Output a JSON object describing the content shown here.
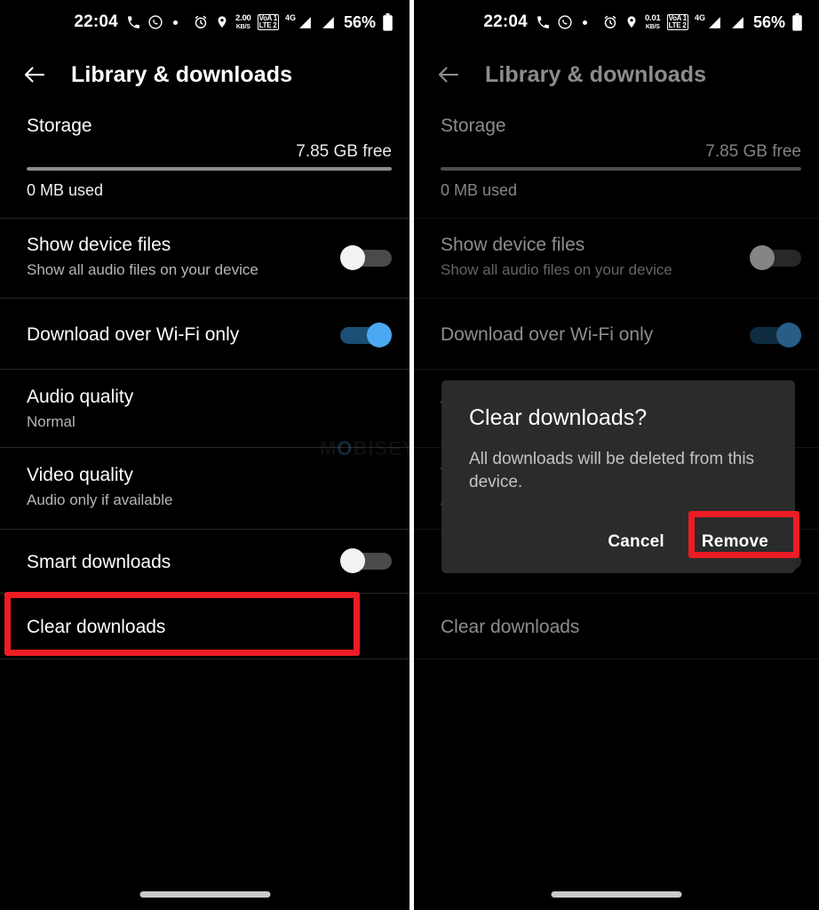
{
  "status_bar": {
    "time": "22:04",
    "icons": [
      "phone-icon",
      "whatsapp-icon",
      "dot-icon",
      "alarm-icon",
      "location-icon"
    ],
    "net_speed_left": "2.00",
    "net_speed_right": "0.01",
    "net_speed_unit": "KB/S",
    "volte_line1": "VoA 1",
    "volte_line2": "LTE 2",
    "network_type": "4G",
    "battery_percent": "56%"
  },
  "app_bar": {
    "back_icon": "arrow-back-icon",
    "title": "Library & downloads"
  },
  "storage": {
    "label": "Storage",
    "free": "7.85 GB free",
    "used": "0 MB used",
    "used_percent": 0
  },
  "rows": [
    {
      "name": "show-device-files",
      "title": "Show device files",
      "subtitle": "Show all audio files on your device",
      "control": "toggle",
      "toggle_state": "off"
    },
    {
      "name": "download-over-wifi-only",
      "title": "Download over Wi-Fi only",
      "subtitle": "",
      "control": "toggle",
      "toggle_state": "on"
    },
    {
      "name": "audio-quality",
      "title": "Audio quality",
      "subtitle": "Normal",
      "control": "none",
      "toggle_state": ""
    },
    {
      "name": "video-quality",
      "title": "Video quality",
      "subtitle": "Audio only if available",
      "control": "none",
      "toggle_state": ""
    },
    {
      "name": "smart-downloads",
      "title": "Smart downloads",
      "subtitle": "",
      "control": "toggle",
      "toggle_state": "off"
    },
    {
      "name": "clear-downloads",
      "title": "Clear downloads",
      "subtitle": "",
      "control": "none",
      "toggle_state": ""
    }
  ],
  "dialog": {
    "title": "Clear downloads?",
    "message": "All downloads will be deleted from this device.",
    "cancel_label": "Cancel",
    "confirm_label": "Remove"
  },
  "annotations": {
    "highlight_color": "#ed1c24",
    "left_target": "Clear downloads",
    "right_target": "Remove"
  },
  "watermark": {
    "text_before": "M",
    "text_o": "O",
    "text_after": "BISEYANA"
  }
}
